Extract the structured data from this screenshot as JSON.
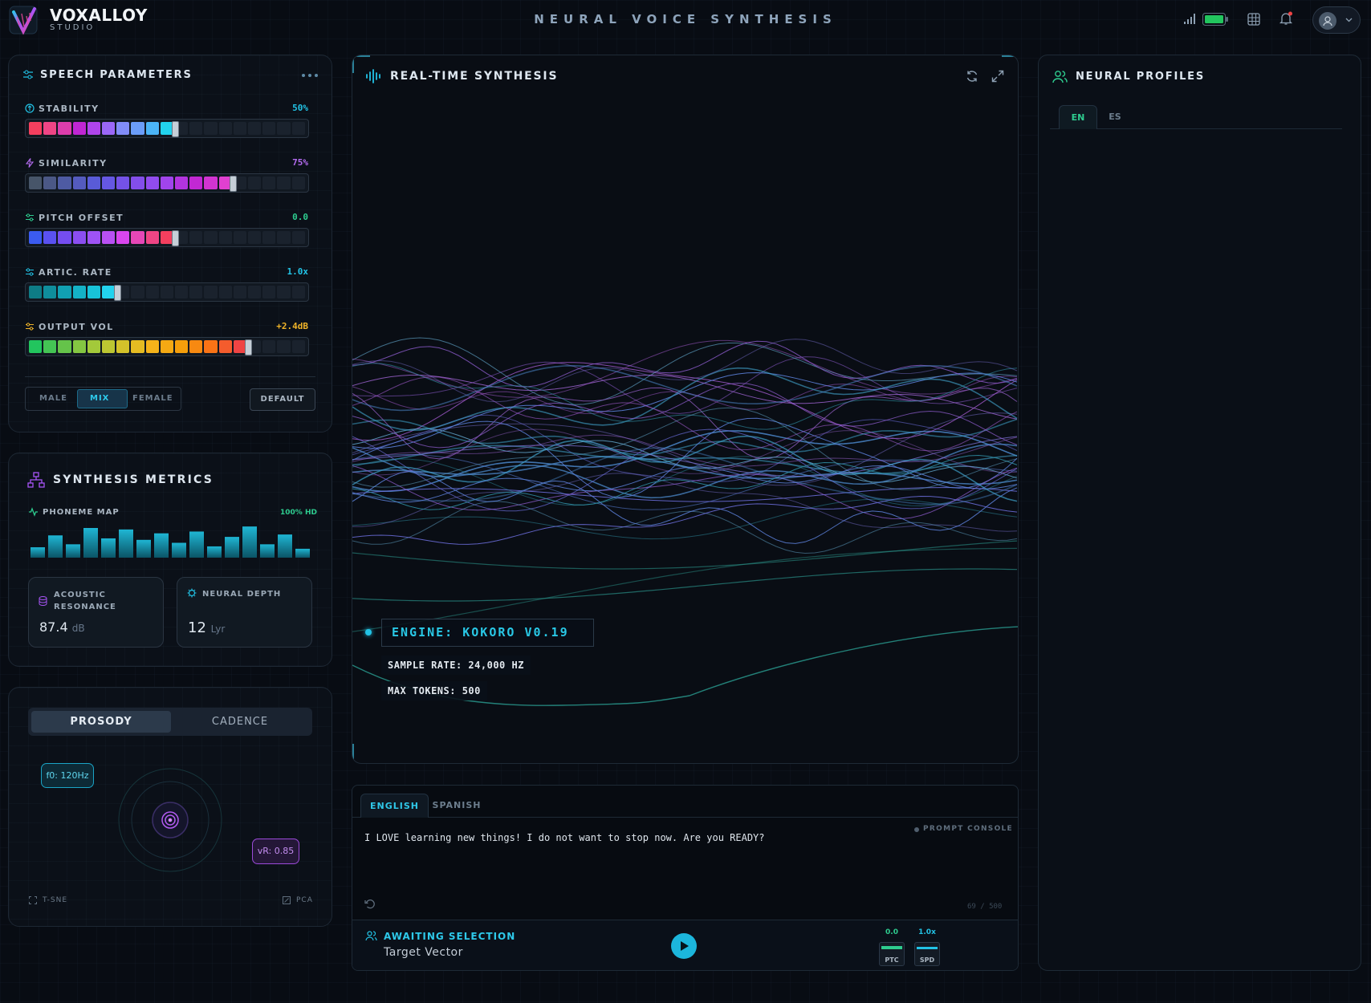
{
  "header": {
    "brand": "VOXALLOY",
    "brand_sub": "STUDIO",
    "title": "NEURAL VOICE SYNTHESIS",
    "battery_color": "#22c55e"
  },
  "speech_parameters": {
    "title": "SPEECH PARAMETERS",
    "params": [
      {
        "label": "STABILITY",
        "value": "50%",
        "color": "#22c3e6",
        "icon": "stability-icon",
        "level": 0.5
      },
      {
        "label": "SIMILARITY",
        "value": "75%",
        "color": "#b46cf0",
        "icon": "lightning-icon",
        "level": 0.75
      },
      {
        "label": "PITCH OFFSET",
        "value": "0.0",
        "color": "#2ecc8f",
        "icon": "sliders-icon",
        "level": 0.5
      },
      {
        "label": "ARTIC. RATE",
        "value": "1.0x",
        "color": "#22c3e6",
        "icon": "sliders-icon",
        "level": 0.33
      },
      {
        "label": "OUTPUT VOL",
        "value": "+2.4dB",
        "color": "#f0b429",
        "icon": "sliders-icon",
        "level": 0.8
      }
    ],
    "voice_mode": {
      "options": [
        "MALE",
        "MIX",
        "FEMALE"
      ],
      "selected": "MIX"
    },
    "default_label": "DEFAULT"
  },
  "metrics": {
    "title": "SYNTHESIS METRICS",
    "phoneme_label": "PHONEME MAP",
    "phoneme_badge": "100% HD",
    "phoneme_bars": [
      0.35,
      0.75,
      0.45,
      1.0,
      0.65,
      0.95,
      0.6,
      0.82,
      0.5,
      0.88,
      0.38,
      0.7,
      1.05,
      0.45,
      0.78,
      0.3
    ],
    "acoustic": {
      "label_1": "ACOUSTIC",
      "label_2": "RESONANCE",
      "value": "87.4",
      "unit": "dB"
    },
    "neural": {
      "label": "NEURAL DEPTH",
      "value": "12",
      "unit": "Lyr"
    }
  },
  "prosody": {
    "tabs": [
      "PROSODY",
      "CADENCE"
    ],
    "f0_chip": "f0: 120Hz",
    "vr_chip": "vR: 0.85",
    "tsne_label": "T-SNE",
    "pca_label": "PCA"
  },
  "synthesis": {
    "title": "REAL-TIME SYNTHESIS",
    "engine": "ENGINE: KOKORO V0.19",
    "sample_rate": "SAMPLE RATE: 24,000 HZ",
    "max_tokens": "MAX TOKENS: 500"
  },
  "console": {
    "tabs": [
      "ENGLISH",
      "SPANISH"
    ],
    "label": "PROMPT CONSOLE",
    "prompt": "I LOVE learning new things! I do not want to stop now. Are you READY?",
    "char_count": "69 / 500",
    "status_title": "AWAITING SELECTION",
    "status_sub": "Target Vector",
    "ptc_value": "0.0",
    "ptc_label": "PTC",
    "spd_value": "1.0x",
    "spd_label": "SPD"
  },
  "profiles": {
    "title": "NEURAL PROFILES",
    "tabs": [
      "EN",
      "ES"
    ]
  }
}
